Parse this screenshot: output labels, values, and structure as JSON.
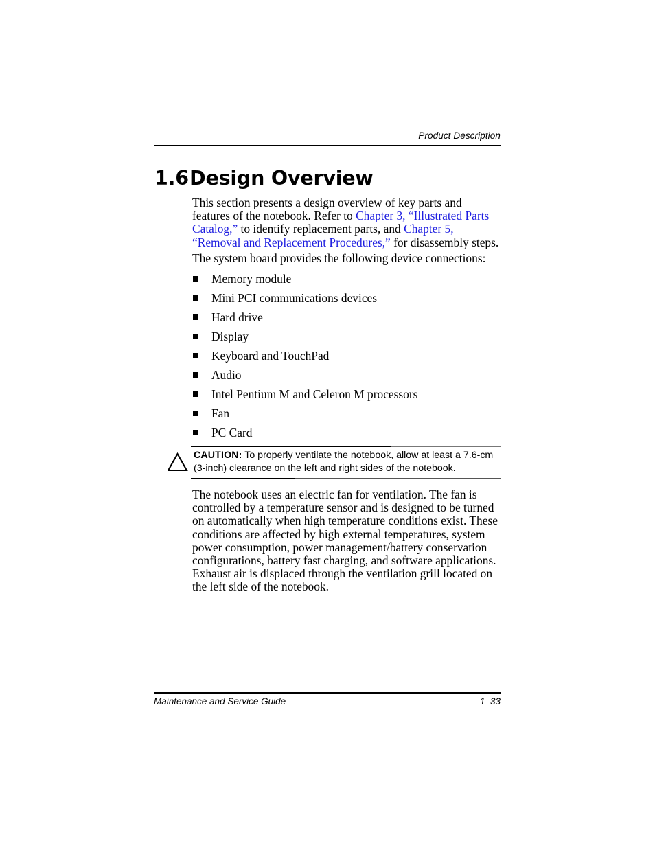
{
  "page": {
    "header_title": "Product Description",
    "footer_left": "Maintenance and Service Guide",
    "footer_page_number": "1–33"
  },
  "section": {
    "number": "1.6",
    "title": "Design Overview"
  },
  "paragraphs": {
    "intro_part1": "This section presents a design overview of key parts and features of the notebook. Refer to ",
    "intro_link1": "Chapter 3, “Illustrated Parts Catalog,”",
    "intro_part2": " to identify replacement parts, and ",
    "intro_link2": "Chapter 5, “Removal and Replacement Procedures,”",
    "intro_part3": " for disassembly steps.",
    "lead_in": "The system board provides the following device connections:",
    "fan": "The notebook uses an electric fan for ventilation. The fan is controlled by a temperature sensor and is designed to be turned on automatically when high temperature conditions exist. These conditions are affected by high external temperatures, system power consumption, power management/battery conservation configurations, battery fast charging, and software applications. Exhaust air is displaced through the ventilation grill located on the left side of the notebook."
  },
  "device_connections": [
    "Memory module",
    "Mini PCI communications devices",
    "Hard drive",
    "Display",
    "Keyboard and TouchPad",
    "Audio",
    "Intel Pentium M and Celeron M processors",
    "Fan",
    "PC Card"
  ],
  "caution": {
    "icon": "warning-triangle-icon",
    "label": "CAUTION:",
    "text": " To properly ventilate the notebook, allow at least a 7.6-cm (3-inch) clearance on the left and right sides of the notebook."
  },
  "colors": {
    "link": "#1d1de0",
    "text": "#000000",
    "background": "#ffffff"
  }
}
